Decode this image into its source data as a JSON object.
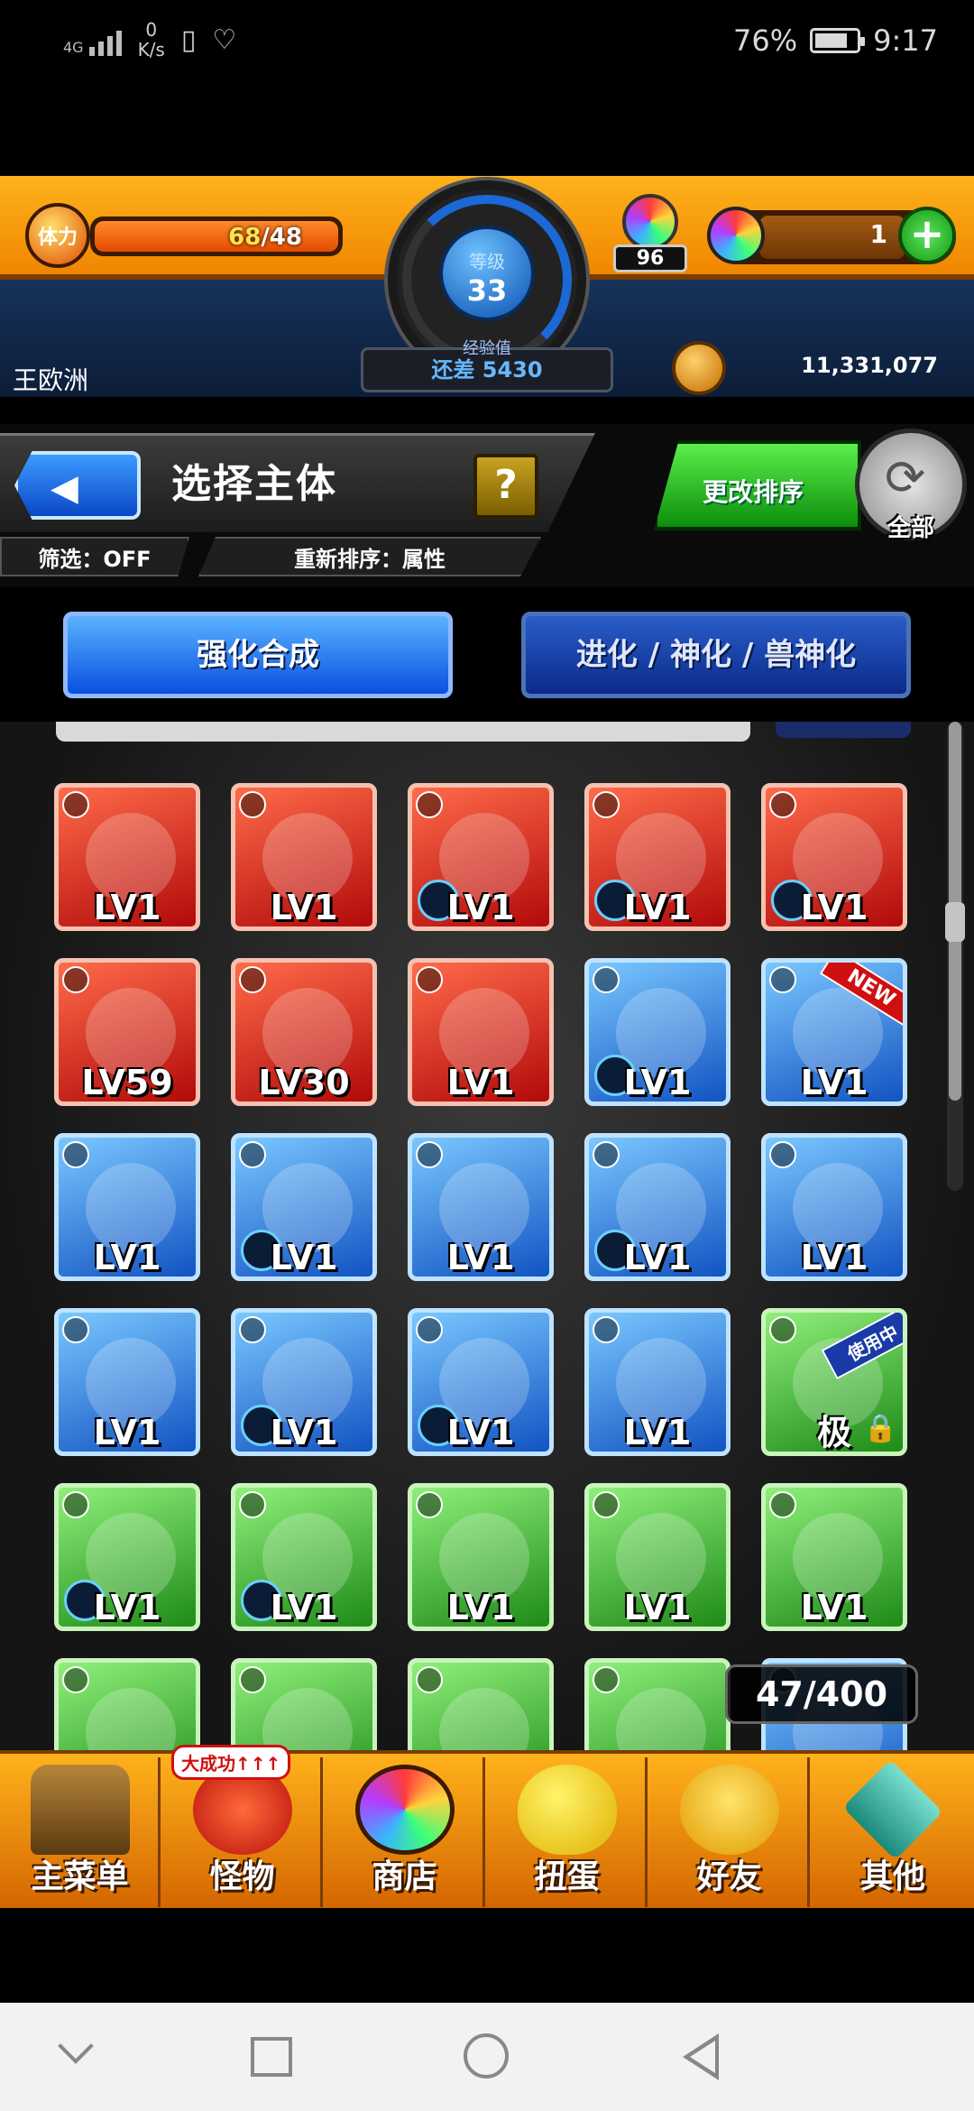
{
  "status_bar": {
    "network": "4G",
    "speed_value": "0",
    "speed_unit": "K/s",
    "battery": "76%",
    "time": "9:17"
  },
  "hud": {
    "stamina_label": "体力",
    "stamina_current": "68",
    "stamina_max": "/48",
    "level_label": "等级",
    "level_value": "33",
    "exp_label": "经验值",
    "exp_remaining": "还差 5430",
    "orb_count": "96",
    "gem_count": "1",
    "username": "王欧洲",
    "coins": "11,331,077"
  },
  "header": {
    "title": "选择主体",
    "help_label": "?",
    "filter_label": "筛选：OFF",
    "resort_label": "重新排序：属性",
    "sort_button": "更改排序",
    "all_label": "全部"
  },
  "modes": {
    "enhance": "强化合成",
    "evolve": "进化 / 神化 / 兽神化"
  },
  "monsters": [
    {
      "element": "fire",
      "level": "LV1"
    },
    {
      "element": "fire",
      "level": "LV1"
    },
    {
      "element": "fire",
      "level": "LV1",
      "soul": true
    },
    {
      "element": "fire",
      "level": "LV1",
      "soul": true
    },
    {
      "element": "fire",
      "level": "LV1",
      "soul": true
    },
    {
      "element": "fire",
      "level": "LV59"
    },
    {
      "element": "fire",
      "level": "LV30"
    },
    {
      "element": "fire",
      "level": "LV1"
    },
    {
      "element": "water",
      "level": "LV1",
      "soul": true
    },
    {
      "element": "water",
      "level": "LV1",
      "tag": "NEW"
    },
    {
      "element": "water",
      "level": "LV1"
    },
    {
      "element": "water",
      "level": "LV1",
      "soul": true
    },
    {
      "element": "water",
      "level": "LV1"
    },
    {
      "element": "water",
      "level": "LV1",
      "soul": true
    },
    {
      "element": "water",
      "level": "LV1"
    },
    {
      "element": "water",
      "level": "LV1"
    },
    {
      "element": "water",
      "level": "LV1",
      "soul": true
    },
    {
      "element": "water",
      "level": "LV1",
      "soul": true
    },
    {
      "element": "water",
      "level": "LV1"
    },
    {
      "element": "wood",
      "level": "极",
      "tag": "使用中",
      "locked": true
    },
    {
      "element": "wood",
      "level": "LV1",
      "soul": true
    },
    {
      "element": "wood",
      "level": "LV1",
      "soul": true
    },
    {
      "element": "wood",
      "level": "LV1"
    },
    {
      "element": "wood",
      "level": "LV1"
    },
    {
      "element": "wood",
      "level": "LV1"
    },
    {
      "element": "wood",
      "level": ""
    },
    {
      "element": "wood",
      "level": ""
    },
    {
      "element": "wood",
      "level": ""
    },
    {
      "element": "wood",
      "level": ""
    },
    {
      "element": "water",
      "level": ""
    }
  ],
  "box_count": "47/400",
  "bottom_nav": {
    "items": [
      {
        "label": "主菜单",
        "icon": "castle-gate-icon"
      },
      {
        "label": "怪物",
        "icon": "red-dragon-icon"
      },
      {
        "label": "商店",
        "icon": "rainbow-orb-icon"
      },
      {
        "label": "扭蛋",
        "icon": "egg-icon"
      },
      {
        "label": "好友",
        "icon": "friends-icon"
      },
      {
        "label": "其他",
        "icon": "question-diamond-icon"
      }
    ],
    "badge": "大成功↑↑↑"
  },
  "colors": {
    "hud_orange": "#ffb21c",
    "navy": "#17325a",
    "fire": "#d8231a",
    "water": "#2a7de0",
    "wood": "#3ab82a",
    "primary_button": "#0a4fe0",
    "sort_green": "#1fae1f"
  }
}
